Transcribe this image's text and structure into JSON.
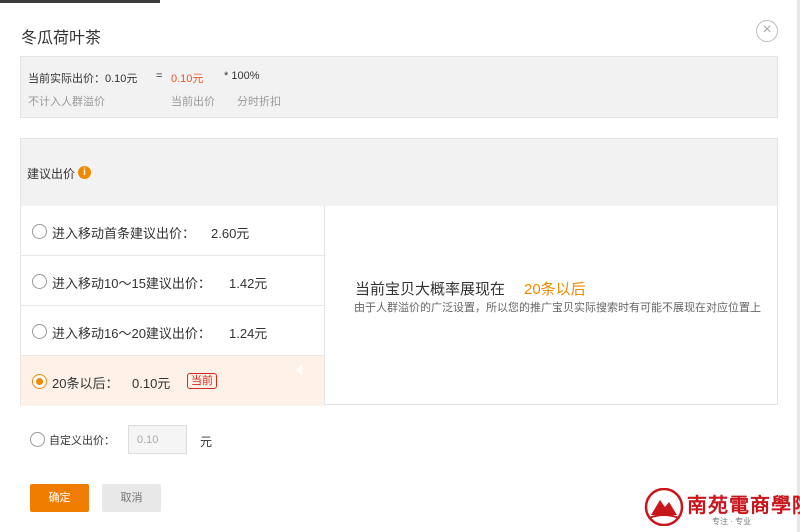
{
  "dialog": {
    "title": "冬瓜荷叶茶",
    "close_symbol": "×"
  },
  "summary": {
    "main_label": "当前实际出价：0.10元",
    "equals": "=",
    "current_bid": "0.10元",
    "multiply": "*  100%",
    "sub_labels": [
      "不计入人群溢价",
      "当前出价",
      "分时折扣"
    ]
  },
  "suggest": {
    "title": "建议出价",
    "info_symbol": "i",
    "options": [
      {
        "label": "进入移动首条建议出价：",
        "price": "2.60元",
        "selected": false
      },
      {
        "label": "进入移动10～15建议出价：",
        "price": "1.42元",
        "selected": false
      },
      {
        "label": "进入移动16～20建议出价：",
        "price": "1.24元",
        "selected": false
      },
      {
        "label": "20条以后：",
        "price": "0.10元",
        "selected": true,
        "badge": "当前"
      }
    ],
    "detail_main": "当前宝贝大概率展现在",
    "detail_highlight": "20条以后",
    "detail_sub": "由于人群溢价的广泛设置，所以您的推广宝贝实际搜索时有可能不展现在对应位置上"
  },
  "custom": {
    "label": "自定义出价：",
    "value": "0.10",
    "unit": "元"
  },
  "buttons": {
    "confirm": "确定",
    "cancel": "取消"
  },
  "watermark": {
    "name": "南苑電商學院",
    "slogan": "专注 · 专业"
  },
  "colors": {
    "accent": "#f08a00",
    "price_red": "#e8562a",
    "badge_red": "#d9281e"
  }
}
